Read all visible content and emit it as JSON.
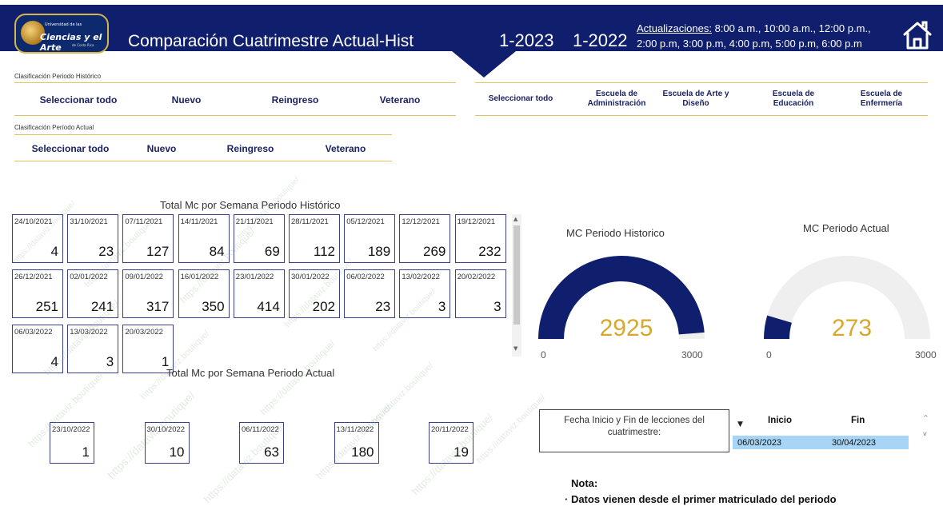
{
  "header": {
    "logo": {
      "small": "Universidad de las",
      "big": "Ciencias y el Arte",
      "tiny": "de Costa Rica"
    },
    "title": "Comparación Cuatrimestre Actual-Hist",
    "period_actual": "1-2023",
    "period_hist": "1-2022",
    "updates_label": "Actualizaciones:",
    "updates_line1": " 8:00 a.m., 10:00 a.m., 12:00 p.m.,",
    "updates_line2": "2:00 p.m, 3:00 p.m, 4:00 p.m, 5:00 p.m, 6:00 p.m",
    "home_icon": "home-icon",
    "band_color": "#0f1f6e"
  },
  "slicer_hist": {
    "label": "Clasificación Periodo Histórico",
    "items": [
      "Seleccionar todo",
      "Nuevo",
      "Reingreso",
      "Veterano"
    ]
  },
  "slicer_actual": {
    "label": "Clasificación Período Actual",
    "items": [
      "Seleccionar todo",
      "Nuevo",
      "Reingreso",
      "Veterano"
    ]
  },
  "slicer_escuela": {
    "items": [
      "Seleccionar todo",
      "Escuela de Administración",
      "Escuela de Arte y Diseño",
      "Escuela de Educación",
      "Escuela de Enfermería"
    ]
  },
  "hist_weeks": {
    "title": "Total Mc por Semana Periodo Histórico",
    "cards": [
      {
        "date": "24/10/2021",
        "value": "4"
      },
      {
        "date": "31/10/2021",
        "value": "23"
      },
      {
        "date": "07/11/2021",
        "value": "127"
      },
      {
        "date": "14/11/2021",
        "value": "84"
      },
      {
        "date": "21/11/2021",
        "value": "69"
      },
      {
        "date": "28/11/2021",
        "value": "112"
      },
      {
        "date": "05/12/2021",
        "value": "189"
      },
      {
        "date": "12/12/2021",
        "value": "269"
      },
      {
        "date": "19/12/2021",
        "value": "232"
      },
      {
        "date": "26/12/2021",
        "value": "251"
      },
      {
        "date": "02/01/2022",
        "value": "241"
      },
      {
        "date": "09/01/2022",
        "value": "317"
      },
      {
        "date": "16/01/2022",
        "value": "350"
      },
      {
        "date": "23/01/2022",
        "value": "414"
      },
      {
        "date": "30/01/2022",
        "value": "202"
      },
      {
        "date": "06/02/2022",
        "value": "23"
      },
      {
        "date": "13/02/2022",
        "value": "3"
      },
      {
        "date": "20/02/2022",
        "value": "3"
      },
      {
        "date": "06/03/2022",
        "value": "4"
      },
      {
        "date": "13/03/2022",
        "value": "3"
      },
      {
        "date": "20/03/2022",
        "value": "1"
      }
    ]
  },
  "actual_weeks": {
    "title": "Total Mc por Semana Periodo Actual",
    "cards": [
      {
        "date": "23/10/2022",
        "value": "1"
      },
      {
        "date": "30/10/2022",
        "value": "10"
      },
      {
        "date": "06/11/2022",
        "value": "63"
      },
      {
        "date": "13/11/2022",
        "value": "180"
      },
      {
        "date": "20/11/2022",
        "value": "19"
      }
    ]
  },
  "gauge_hist": {
    "title": "MC Periodo Historico",
    "value": 2925,
    "value_text": "2925",
    "min": "0",
    "max": "3000",
    "max_value": 3000,
    "fill_color": "#0f1f6e"
  },
  "gauge_actual": {
    "title": "MC Periodo Actual",
    "value": 273,
    "value_text": "273",
    "min": "0",
    "max": "3000",
    "max_value": 3000,
    "fill_color": "#0f1f6e"
  },
  "dates": {
    "label": "Fecha Inicio y Fin de lecciones del cuatrimestre:",
    "col_inicio": "Inicio",
    "col_fin": "Fin",
    "inicio": "06/03/2023",
    "fin": "30/04/2023"
  },
  "note": {
    "title": "Nota:",
    "line1": "· Datos vienen desde el primer matriculado del periodo"
  },
  "watermark": {
    "text": "https://dataviz.boutique/"
  }
}
